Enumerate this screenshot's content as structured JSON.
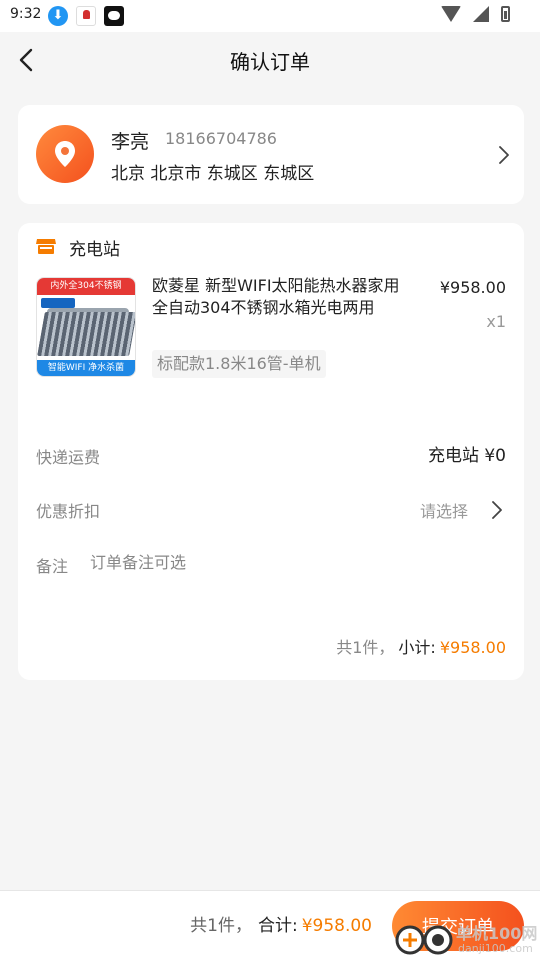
{
  "status_bar": {
    "time": "9:32",
    "download_glyph": "⬇"
  },
  "header": {
    "title": "确认订单"
  },
  "address": {
    "name": "李亮",
    "phone": "18166704786",
    "line": "北京 北京市 东城区 东城区"
  },
  "shop": {
    "name": "充电站"
  },
  "product": {
    "title": "欧菱星 新型WIFI太阳能热水器家用全自动304不锈钢水箱光电两用",
    "spec": "标配款1.8米16管-单机",
    "price": "¥958.00",
    "quantity": "x1",
    "image_banner": "内外全304不锈钢",
    "image_footer": "智能WIFI 净水杀菌"
  },
  "shipping": {
    "label": "快递运费",
    "value": "充电站 ¥0"
  },
  "discount": {
    "label": "优惠折扣",
    "value": "请选择"
  },
  "note": {
    "label": "备注",
    "placeholder": "订单备注可选"
  },
  "subtotal": {
    "count": "共1件，",
    "label": "小计:",
    "amount": "¥958.00"
  },
  "bottom_bar": {
    "count": "共1件，",
    "total_label": "合计:",
    "total_amount": "¥958.00",
    "submit_label": "提交订单"
  },
  "watermark": {
    "text": "单机100网",
    "url": "danji100.com"
  },
  "colors": {
    "accent": "#f57c00",
    "button_start": "#ff8a33",
    "button_end": "#f4511e"
  }
}
